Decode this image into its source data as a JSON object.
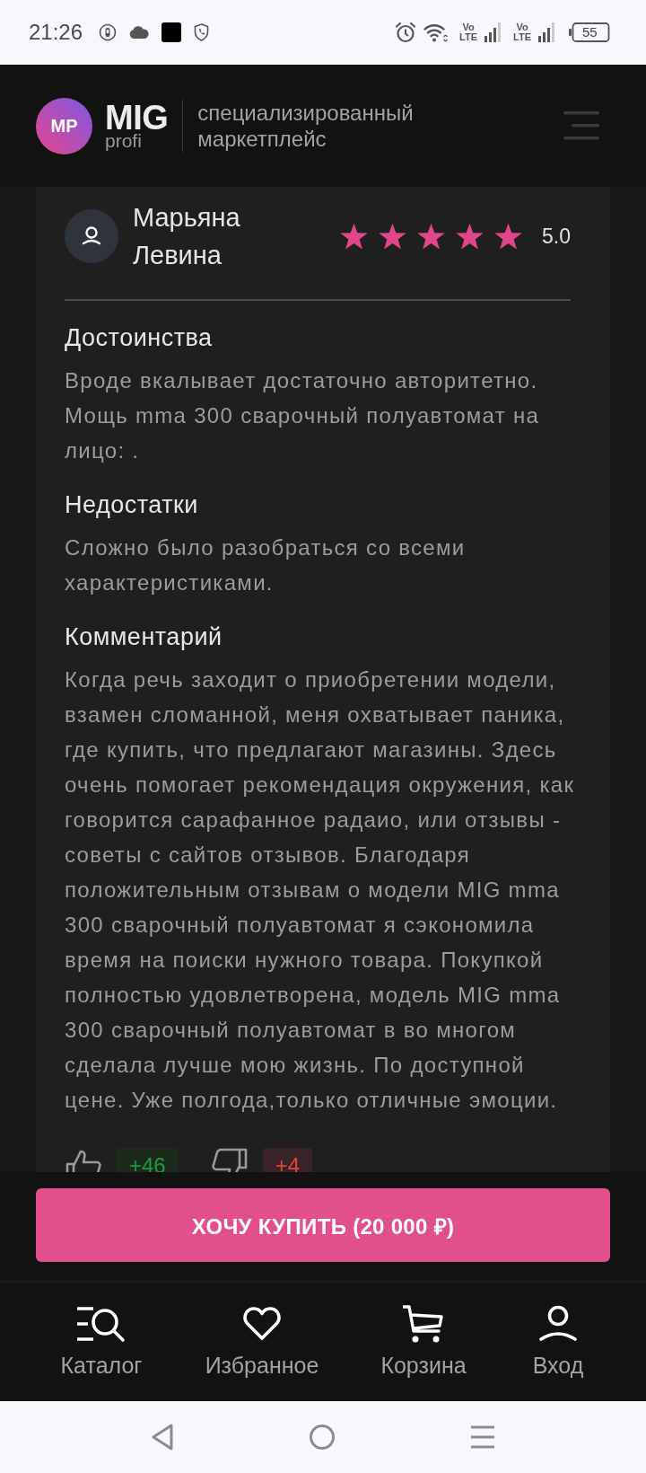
{
  "status_bar": {
    "time": "21:26",
    "network": [
      {
        "top": "Vo",
        "bottom": "LTE"
      },
      {
        "top": "Vo",
        "bottom": "LTE"
      }
    ],
    "battery": "55"
  },
  "header": {
    "logo_badge": "MP",
    "logo_title": "MIG",
    "logo_subtitle": "profi",
    "tagline": "специализированный маркетплейс"
  },
  "review": {
    "author": "Марьяна Левина",
    "stars": 5,
    "rating": "5.0",
    "sections": [
      {
        "title": "Достоинства",
        "text": "Вроде вкалывает достаточно авторитетно. Мощь mma 300 сварочный полуавтомат на лицо: ."
      },
      {
        "title": "Недостатки",
        "text": "Сложно было разобраться со всеми характеристиками."
      },
      {
        "title": "Комментарий",
        "text": "Когда речь заходит о приобретении модели, взамен сломанной, меня охватывает паника, где купить, что предлагают магазины. Здесь очень помогает рекомендация окружения, как говорится сарафанное радаио, или отзывы - советы с сайтов отзывов. Благодаря положительным отзывам о модели MIG mma 300 сварочный полуавтомат я сэкономила время на поиски нужного товара. Покупкой полностью удовлетворена, модель MIG mma 300 сварочный полуавтомат в во многом сделала лучше мою жизнь. По доступной цене. Уже полгода,только отличные эмоции."
      }
    ],
    "votes": [
      {
        "kind": "up",
        "count": "+46"
      },
      {
        "kind": "down",
        "count": "+4"
      }
    ]
  },
  "buy_button": {
    "label": "ХОЧУ КУПИТЬ (20 000 ₽)"
  },
  "bottom_nav": [
    {
      "kind": "catalog",
      "label": "Каталог"
    },
    {
      "kind": "favorites",
      "label": "Избранное"
    },
    {
      "kind": "cart",
      "label": "Корзина"
    },
    {
      "kind": "login",
      "label": "Вход"
    }
  ]
}
